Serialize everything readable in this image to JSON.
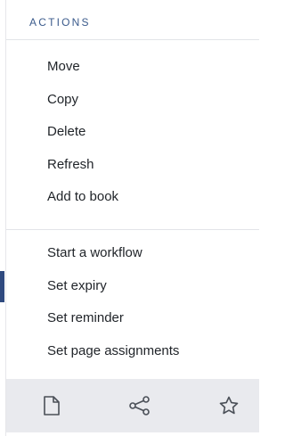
{
  "actions_panel": {
    "title": "ACTIONS",
    "group_1": [
      {
        "label": "Move"
      },
      {
        "label": "Copy"
      },
      {
        "label": "Delete"
      },
      {
        "label": "Refresh"
      },
      {
        "label": "Add to book"
      }
    ],
    "group_2": [
      {
        "label": "Start a workflow"
      },
      {
        "label": "Set expiry"
      },
      {
        "label": "Set reminder"
      },
      {
        "label": "Set page assignments"
      }
    ],
    "active_item": "Set expiry"
  },
  "toolbar": {
    "icons": [
      "document-icon",
      "share-icon",
      "star-icon"
    ]
  },
  "colors": {
    "accent": "#2f4a7f",
    "title": "#3b5b8c",
    "toolbar_bg": "#e9eaee",
    "divider": "#e2e4e8"
  }
}
